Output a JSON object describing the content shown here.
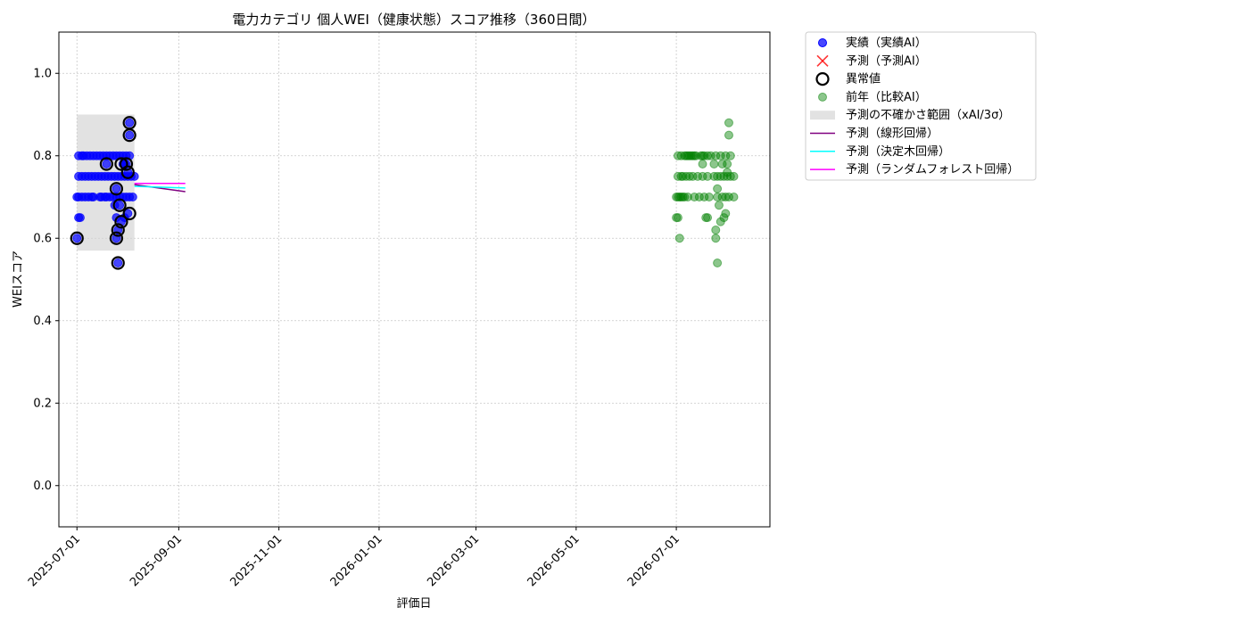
{
  "chart_data": {
    "type": "scatter",
    "title": "電力カテゴリ 個人WEI（健康状態）スコア推移（360日間）",
    "xlabel": "評価日",
    "ylabel": "WEIスコア",
    "xlim": [
      "2025-06-20",
      "2026-08-27"
    ],
    "ylim": [
      -0.1,
      1.1
    ],
    "yticks": [
      0.0,
      0.2,
      0.4,
      0.6,
      0.8,
      1.0
    ],
    "yticklabels": [
      "0.0",
      "0.2",
      "0.4",
      "0.6",
      "0.8",
      "1.0"
    ],
    "xticks": [
      "2025-07-01",
      "2025-09-01",
      "2025-11-01",
      "2026-01-01",
      "2026-03-01",
      "2026-05-01",
      "2026-07-01"
    ],
    "grid": true,
    "legend_position": "outside-right-top",
    "colors": {
      "actual": "#0000ff",
      "comparison": "#008000",
      "anomaly": "#000000",
      "forecast_marker": "#ff0000",
      "band": "#d3d3d3",
      "linear": "#800080",
      "tree": "#00ffff",
      "forest": "#ff00ff"
    },
    "legend": [
      {
        "label": "実績（実績AI）",
        "kind": "dot-blue"
      },
      {
        "label": "予測（予測AI）",
        "kind": "x-red"
      },
      {
        "label": "異常値",
        "kind": "ring"
      },
      {
        "label": "前年（比較AI）",
        "kind": "dot-green"
      },
      {
        "label": "予測の不確かさ範囲（xAI/3σ）",
        "kind": "band"
      },
      {
        "label": "予測（線形回帰）",
        "kind": "line-purple"
      },
      {
        "label": "予測（決定木回帰）",
        "kind": "line-cyan"
      },
      {
        "label": "予測（ランダムフォレスト回帰）",
        "kind": "line-magenta"
      }
    ],
    "uncertainty_band": {
      "x": [
        "2025-07-01",
        "2025-08-05"
      ],
      "y": [
        0.57,
        0.9
      ]
    },
    "series": [
      {
        "name": "実績（実績AI）",
        "marker": "dot",
        "points": [
          [
            "2025-07-01",
            0.6
          ],
          [
            "2025-07-02",
            0.65
          ],
          [
            "2025-07-03",
            0.65
          ],
          [
            "2025-07-01",
            0.7
          ],
          [
            "2025-07-02",
            0.7
          ],
          [
            "2025-07-04",
            0.7
          ],
          [
            "2025-07-06",
            0.7
          ],
          [
            "2025-07-08",
            0.7
          ],
          [
            "2025-07-10",
            0.7
          ],
          [
            "2025-07-11",
            0.7
          ],
          [
            "2025-07-02",
            0.75
          ],
          [
            "2025-07-04",
            0.75
          ],
          [
            "2025-07-06",
            0.75
          ],
          [
            "2025-07-08",
            0.75
          ],
          [
            "2025-07-10",
            0.75
          ],
          [
            "2025-07-12",
            0.75
          ],
          [
            "2025-07-14",
            0.75
          ],
          [
            "2025-07-16",
            0.75
          ],
          [
            "2025-07-02",
            0.8
          ],
          [
            "2025-07-04",
            0.8
          ],
          [
            "2025-07-05",
            0.8
          ],
          [
            "2025-07-07",
            0.8
          ],
          [
            "2025-07-09",
            0.8
          ],
          [
            "2025-07-11",
            0.8
          ],
          [
            "2025-07-13",
            0.8
          ],
          [
            "2025-07-15",
            0.7
          ],
          [
            "2025-07-16",
            0.7
          ],
          [
            "2025-07-18",
            0.7
          ],
          [
            "2025-07-19",
            0.7
          ],
          [
            "2025-07-21",
            0.7
          ],
          [
            "2025-07-23",
            0.7
          ],
          [
            "2025-07-25",
            0.7
          ],
          [
            "2025-07-27",
            0.7
          ],
          [
            "2025-07-29",
            0.7
          ],
          [
            "2025-07-31",
            0.7
          ],
          [
            "2025-08-02",
            0.7
          ],
          [
            "2025-08-04",
            0.7
          ],
          [
            "2025-07-18",
            0.75
          ],
          [
            "2025-07-20",
            0.75
          ],
          [
            "2025-07-22",
            0.75
          ],
          [
            "2025-07-24",
            0.75
          ],
          [
            "2025-07-26",
            0.75
          ],
          [
            "2025-07-28",
            0.75
          ],
          [
            "2025-07-30",
            0.75
          ],
          [
            "2025-08-01",
            0.75
          ],
          [
            "2025-08-03",
            0.75
          ],
          [
            "2025-08-05",
            0.75
          ],
          [
            "2025-07-15",
            0.8
          ],
          [
            "2025-07-17",
            0.8
          ],
          [
            "2025-07-19",
            0.8
          ],
          [
            "2025-07-21",
            0.8
          ],
          [
            "2025-07-23",
            0.8
          ],
          [
            "2025-07-25",
            0.8
          ],
          [
            "2025-07-27",
            0.8
          ],
          [
            "2025-07-29",
            0.8
          ],
          [
            "2025-07-31",
            0.8
          ],
          [
            "2025-08-02",
            0.8
          ],
          [
            "2025-07-19",
            0.78
          ],
          [
            "2025-07-25",
            0.6
          ],
          [
            "2025-07-25",
            0.65
          ],
          [
            "2025-07-26",
            0.62
          ],
          [
            "2025-07-26",
            0.54
          ],
          [
            "2025-07-25",
            0.72
          ],
          [
            "2025-07-27",
            0.68
          ],
          [
            "2025-07-28",
            0.64
          ],
          [
            "2025-07-29",
            0.78
          ],
          [
            "2025-07-30",
            0.78
          ],
          [
            "2025-07-31",
            0.78
          ],
          [
            "2025-08-01",
            0.76
          ],
          [
            "2025-08-01",
            0.66
          ],
          [
            "2025-08-02",
            0.85
          ],
          [
            "2025-08-02",
            0.88
          ],
          [
            "2025-07-24",
            0.68
          ],
          [
            "2025-07-30",
            0.65
          ]
        ]
      },
      {
        "name": "異常値",
        "marker": "ring",
        "points": [
          [
            "2025-07-01",
            0.6
          ],
          [
            "2025-07-19",
            0.78
          ],
          [
            "2025-07-25",
            0.72
          ],
          [
            "2025-07-25",
            0.6
          ],
          [
            "2025-07-26",
            0.62
          ],
          [
            "2025-07-26",
            0.54
          ],
          [
            "2025-07-27",
            0.68
          ],
          [
            "2025-07-28",
            0.64
          ],
          [
            "2025-07-28",
            0.78
          ],
          [
            "2025-07-31",
            0.78
          ],
          [
            "2025-08-01",
            0.76
          ],
          [
            "2025-08-02",
            0.66
          ],
          [
            "2025-08-02",
            0.85
          ],
          [
            "2025-08-02",
            0.88
          ]
        ]
      },
      {
        "name": "前年（比較AI）",
        "marker": "dot",
        "points": [
          [
            "2026-07-01",
            0.7
          ],
          [
            "2026-07-02",
            0.7
          ],
          [
            "2026-07-03",
            0.7
          ],
          [
            "2026-07-04",
            0.7
          ],
          [
            "2026-07-05",
            0.7
          ],
          [
            "2026-07-06",
            0.7
          ],
          [
            "2026-07-08",
            0.7
          ],
          [
            "2026-07-12",
            0.7
          ],
          [
            "2026-07-15",
            0.7
          ],
          [
            "2026-07-18",
            0.7
          ],
          [
            "2026-07-21",
            0.7
          ],
          [
            "2026-07-26",
            0.7
          ],
          [
            "2026-07-29",
            0.7
          ],
          [
            "2026-07-31",
            0.7
          ],
          [
            "2026-08-02",
            0.7
          ],
          [
            "2026-08-05",
            0.7
          ],
          [
            "2026-07-02",
            0.75
          ],
          [
            "2026-07-04",
            0.75
          ],
          [
            "2026-07-05",
            0.75
          ],
          [
            "2026-07-07",
            0.75
          ],
          [
            "2026-07-09",
            0.75
          ],
          [
            "2026-07-11",
            0.75
          ],
          [
            "2026-07-14",
            0.75
          ],
          [
            "2026-07-17",
            0.75
          ],
          [
            "2026-07-20",
            0.75
          ],
          [
            "2026-07-24",
            0.75
          ],
          [
            "2026-07-26",
            0.75
          ],
          [
            "2026-07-28",
            0.75
          ],
          [
            "2026-07-30",
            0.75
          ],
          [
            "2026-08-01",
            0.75
          ],
          [
            "2026-08-03",
            0.75
          ],
          [
            "2026-08-05",
            0.75
          ],
          [
            "2026-07-02",
            0.8
          ],
          [
            "2026-07-04",
            0.8
          ],
          [
            "2026-07-06",
            0.8
          ],
          [
            "2026-07-07",
            0.8
          ],
          [
            "2026-07-08",
            0.8
          ],
          [
            "2026-07-09",
            0.8
          ],
          [
            "2026-07-10",
            0.8
          ],
          [
            "2026-07-11",
            0.8
          ],
          [
            "2026-07-12",
            0.8
          ],
          [
            "2026-07-13",
            0.8
          ],
          [
            "2026-07-16",
            0.8
          ],
          [
            "2026-07-17",
            0.8
          ],
          [
            "2026-07-18",
            0.8
          ],
          [
            "2026-07-20",
            0.8
          ],
          [
            "2026-07-22",
            0.8
          ],
          [
            "2026-07-25",
            0.8
          ],
          [
            "2026-07-28",
            0.8
          ],
          [
            "2026-07-31",
            0.8
          ],
          [
            "2026-08-03",
            0.8
          ],
          [
            "2026-07-01",
            0.65
          ],
          [
            "2026-07-02",
            0.65
          ],
          [
            "2026-07-03",
            0.6
          ],
          [
            "2026-07-19",
            0.65
          ],
          [
            "2026-07-20",
            0.65
          ],
          [
            "2026-07-25",
            0.6
          ],
          [
            "2026-07-25",
            0.62
          ],
          [
            "2026-07-26",
            0.54
          ],
          [
            "2026-07-27",
            0.68
          ],
          [
            "2026-07-28",
            0.64
          ],
          [
            "2026-07-17",
            0.78
          ],
          [
            "2026-07-26",
            0.72
          ],
          [
            "2026-07-30",
            0.65
          ],
          [
            "2026-07-31",
            0.66
          ],
          [
            "2026-07-29",
            0.78
          ],
          [
            "2026-08-01",
            0.76
          ],
          [
            "2026-08-01",
            0.78
          ],
          [
            "2026-08-02",
            0.85
          ],
          [
            "2026-08-02",
            0.88
          ],
          [
            "2026-07-24",
            0.78
          ]
        ]
      },
      {
        "name": "予測（線形回帰）",
        "marker": "line",
        "points": [
          [
            "2025-08-05",
            0.73
          ],
          [
            "2025-09-05",
            0.713
          ]
        ]
      },
      {
        "name": "予測（決定木回帰）",
        "marker": "line",
        "points": [
          [
            "2025-08-05",
            0.726
          ],
          [
            "2025-09-05",
            0.722
          ]
        ]
      },
      {
        "name": "予測（ランダムフォレスト回帰）",
        "marker": "line",
        "points": [
          [
            "2025-08-05",
            0.733
          ],
          [
            "2025-09-05",
            0.733
          ]
        ]
      }
    ]
  }
}
